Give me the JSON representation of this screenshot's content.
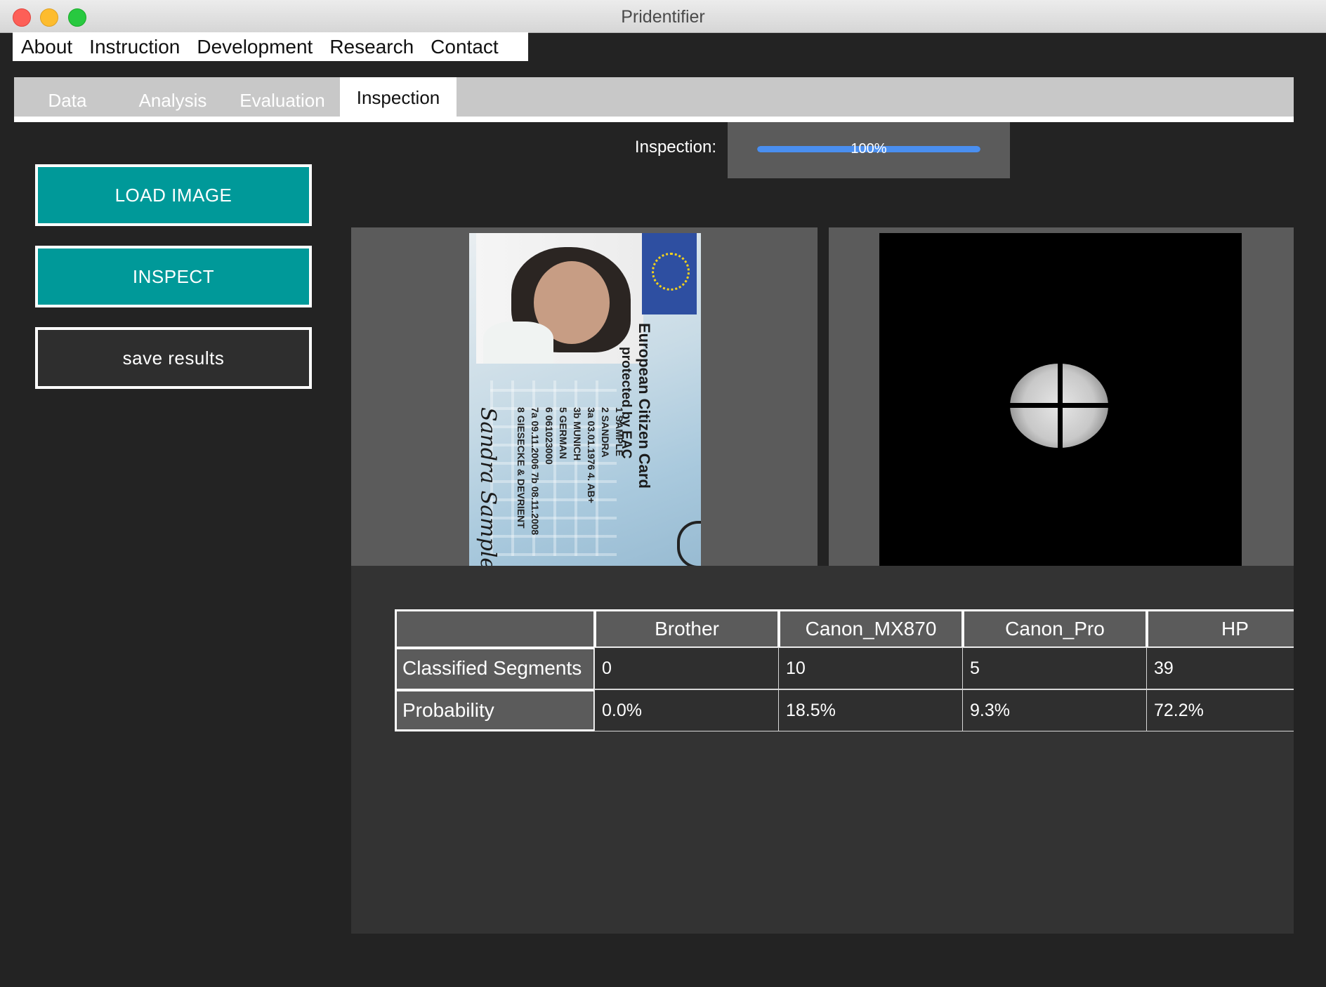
{
  "window": {
    "title": "Pridentifier"
  },
  "menu": [
    "About",
    "Instruction",
    "Development",
    "Research",
    "Contact"
  ],
  "tabs": [
    {
      "label": "Data",
      "active": false
    },
    {
      "label": "Analysis",
      "active": false
    },
    {
      "label": "Evaluation",
      "active": false
    },
    {
      "label": "Inspection",
      "active": true
    }
  ],
  "buttons": {
    "load_image": "LOAD IMAGE",
    "inspect": "INSPECT",
    "save_results": "save results"
  },
  "progress": {
    "label": "Inspection:",
    "value": 1.0,
    "text": "100%",
    "color": "#4a8ff0"
  },
  "card": {
    "title_line1": "European Citizen Card",
    "title_line2": "protected by EAC",
    "fields": [
      "1  SAMPLE",
      "2  SANDRA",
      "3a 03.01.1976   4. AB+",
      "3b MUNICH",
      "5  GERMAN",
      "6  061023000",
      "7a 09.11.2006   7b 08.11.2008",
      "8  GIESECKE & DEVRIENT"
    ],
    "signature": "Sandra Sample"
  },
  "results_table": {
    "columns": [
      "Brother",
      "Canon_MX870",
      "Canon_Pro",
      "HP"
    ],
    "rows": [
      {
        "label": "Classified Segments",
        "values": [
          "0",
          "10",
          "5",
          "39"
        ]
      },
      {
        "label": "Probability",
        "values": [
          "0.0%",
          "18.5%",
          "9.3%",
          "72.2%"
        ]
      }
    ]
  },
  "colors": {
    "accent_teal": "#009999",
    "background": "#232323",
    "panel": "#5b5b5b"
  }
}
